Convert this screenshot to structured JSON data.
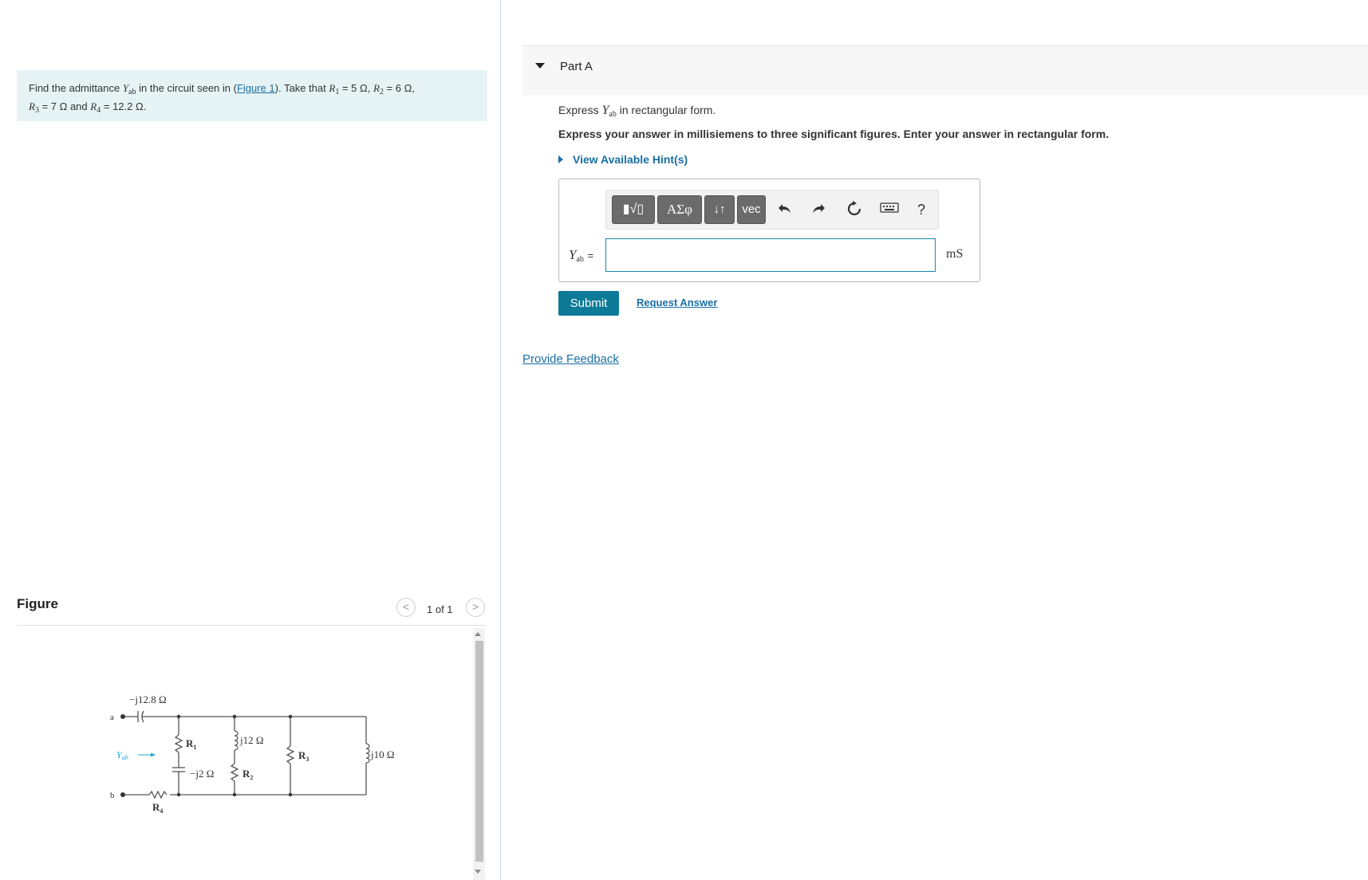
{
  "problem": {
    "text_find": "Find the admittance",
    "var_Y": "Y",
    "var_Y_sub": "ab",
    "text_in_circuit": "in the circuit seen in (",
    "figure_link": "Figure 1",
    "text_take": "). Take that",
    "r1_var": "R",
    "r1_sub": "1",
    "r1_val": "= 5 Ω,",
    "r2_var": "R",
    "r2_sub": "2",
    "r2_val": "= 6 Ω,",
    "r3_var": "R",
    "r3_sub": "3",
    "r3_val": "= 7 Ω and",
    "r4_var": "R",
    "r4_sub": "4",
    "r4_val": "= 12.2 Ω."
  },
  "figure": {
    "title": "Figure",
    "pager_text": "1 of 1",
    "prev_symbol": "<",
    "next_symbol": ">",
    "circuit_labels": {
      "cap_top": "−j12.8 Ω",
      "node_a": "a",
      "node_b": "b",
      "yab": "Y",
      "yab_sub": "ab",
      "r1": "R",
      "r1_sub": "1",
      "cap_mid": "−j2 Ω",
      "ind_1": "j12 Ω",
      "r2": "R",
      "r2_sub": "2",
      "r3": "R",
      "r3_sub": "3",
      "ind_2": "j10 Ω",
      "r4": "R",
      "r4_sub": "4"
    }
  },
  "part": {
    "title": "Part A",
    "instruction_prefix": "Express",
    "instruction_var": "Y",
    "instruction_sub": "ab",
    "instruction_suffix": "in rectangular form.",
    "instruction2": "Express your answer in millisiemens to three significant figures. Enter your answer in rectangular form.",
    "hints_label": "View Available Hint(s)"
  },
  "toolbar": {
    "templates_label": "▮√▯",
    "greek_label": "ΑΣφ",
    "arrows_label": "↓↑",
    "vec_label": "vec",
    "undo_icon": "undo-icon",
    "redo_icon": "redo-icon",
    "reset_icon": "reset-icon",
    "keyboard_icon": "keyboard-icon",
    "help_label": "?"
  },
  "answer": {
    "label_var": "Y",
    "label_sub": "ab",
    "label_eq": "=",
    "value": "",
    "unit": "mS"
  },
  "actions": {
    "submit_label": "Submit",
    "request_answer_label": "Request Answer",
    "feedback_label": "Provide Feedback"
  },
  "colors": {
    "accent": "#0d7a98",
    "link": "#1a6fa5",
    "problem_bg": "#e6f3f5"
  }
}
